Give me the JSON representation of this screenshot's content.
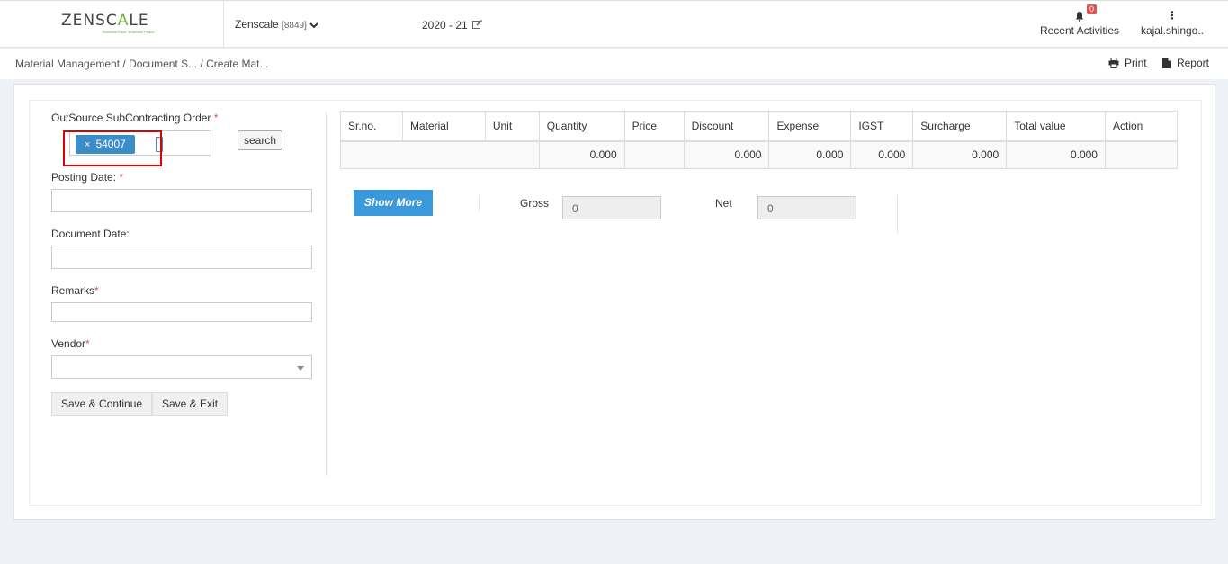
{
  "header": {
    "logo_text_a": "ZENSC",
    "logo_text_b": "A",
    "logo_text_c": "LE",
    "logo_tagline": "Business Ease. Business Peace.",
    "company_name": "Zenscale",
    "company_code": "[8849]",
    "fiscal_year": "2020 - 21",
    "notifications_count": "0",
    "recent_activities_label": "Recent Activities",
    "user_label": "kajal.shingo.."
  },
  "breadcrumb": {
    "items": [
      "Material Management",
      "/ Document S...",
      "/ Create Mat..."
    ]
  },
  "toolbar": {
    "print_label": "Print",
    "report_label": "Report"
  },
  "form": {
    "order_label": "OutSource SubContracting Order",
    "order_tag": "54007",
    "search_label": "search",
    "posting_date_label": "Posting Date:",
    "document_date_label": "Document Date:",
    "remarks_label": "Remarks",
    "vendor_label": "Vendor",
    "required_marker": "*",
    "save_continue_label": "Save & Continue",
    "save_exit_label": "Save & Exit"
  },
  "table": {
    "columns": [
      "Sr.no.",
      "Material",
      "Unit",
      "Quantity",
      "Price",
      "Discount",
      "Expense",
      "IGST",
      "Surcharge",
      "Total value",
      "Action"
    ],
    "totals": {
      "quantity": "0.000",
      "discount": "0.000",
      "expense": "0.000",
      "igst": "0.000",
      "surcharge": "0.000",
      "total_value": "0.000"
    }
  },
  "summary": {
    "show_more_label": "Show More",
    "gross_label": "Gross",
    "gross_value": "0",
    "net_label": "Net",
    "net_value": "0"
  },
  "colors": {
    "accent": "#3a98dc",
    "tag": "#3a8dc7",
    "required": "#d9534f",
    "highlight": "#e00000",
    "logo_green": "#6db33f"
  }
}
